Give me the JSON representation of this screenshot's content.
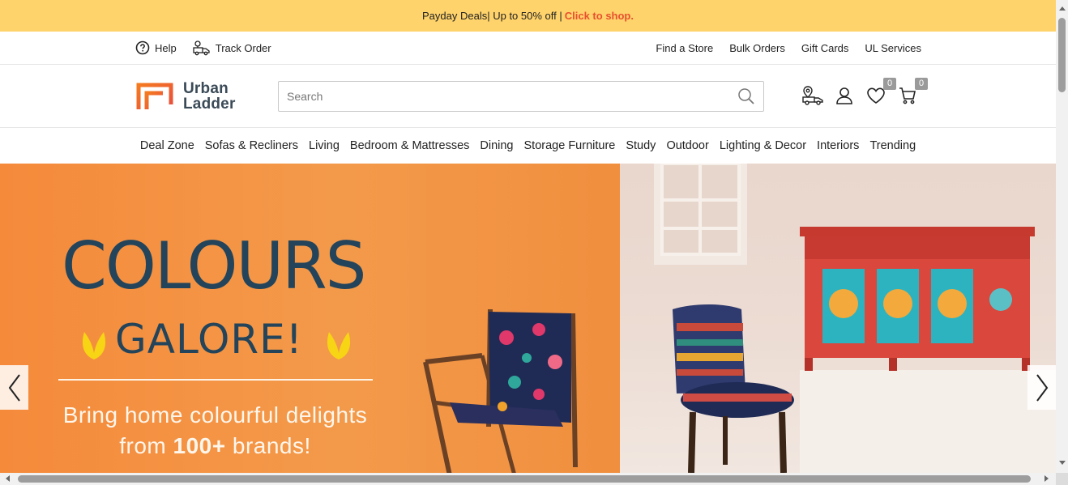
{
  "promo": {
    "text": "Payday Deals| Up to 50% off |",
    "cta": "Click to shop.",
    "bg_color": "#ffd36b",
    "cta_color": "#e8502e"
  },
  "utility_bar": {
    "left": [
      {
        "label": "Help",
        "icon": "help-circle-icon"
      },
      {
        "label": "Track Order",
        "icon": "truck-icon"
      }
    ],
    "right": [
      "Find a Store",
      "Bulk Orders",
      "Gift Cards",
      "UL Services"
    ]
  },
  "header": {
    "logo_line1": "Urban",
    "logo_line2": "Ladder",
    "search_placeholder": "Search",
    "wishlist_count": "0",
    "cart_count": "0",
    "icons": [
      "store-locator-icon",
      "user-icon",
      "heart-icon",
      "cart-icon",
      "search-icon"
    ]
  },
  "nav": [
    "Deal Zone",
    "Sofas & Recliners",
    "Living",
    "Bedroom & Mattresses",
    "Dining",
    "Storage Furniture",
    "Study",
    "Outdoor",
    "Lighting & Decor",
    "Interiors",
    "Trending"
  ],
  "hero": {
    "title": "COLOURS",
    "subtitle": "GALORE!",
    "tagline_line1": "Bring home colourful delights",
    "tagline_line2_pre": "from ",
    "tagline_line2_bold": "100+",
    "tagline_line2_post": " brands!",
    "accent_orange": "#f58a3b",
    "title_color": "#23445a",
    "sprout_color": "#f7d414"
  }
}
